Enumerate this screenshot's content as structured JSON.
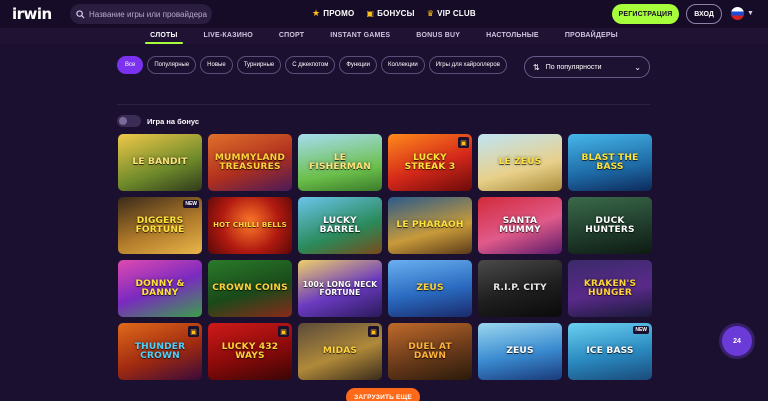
{
  "header": {
    "logo": "irwin",
    "search": {
      "placeholder": "Название игры или провайдера"
    },
    "links": [
      {
        "label": "ПРОМО",
        "icon": "star-icon"
      },
      {
        "label": "БОНУСЫ",
        "icon": "gift-icon"
      },
      {
        "label": "VIP CLUB",
        "icon": "crown-icon"
      }
    ],
    "register_label": "РЕГИСТРАЦИЯ",
    "login_label": "ВХОД",
    "language": "ru"
  },
  "nav": {
    "items": [
      "СЛОТЫ",
      "LIVE-КАЗИНО",
      "СПОРТ",
      "INSTANT GAMES",
      "BONUS BUY",
      "НАСТОЛЬНЫЕ",
      "ПРОВАЙДЕРЫ"
    ],
    "active": "СЛОТЫ"
  },
  "filters": {
    "chips": [
      "Все",
      "Популярные",
      "Новые",
      "Турнирные",
      "С джекпотом",
      "Функции",
      "Коллекции",
      "Игры для хайроллеров"
    ],
    "active": "Все"
  },
  "sort": {
    "label": "По популярности"
  },
  "bonus_toggle": {
    "label": "Игра на бонус",
    "on": false
  },
  "games": [
    {
      "name": "LE BANDIT",
      "badge": ""
    },
    {
      "name": "MUMMYLAND TREASURES",
      "badge": ""
    },
    {
      "name": "LE FISHERMAN",
      "badge": ""
    },
    {
      "name": "LUCKY STREAK 3",
      "badge": "gift"
    },
    {
      "name": "LE ZEUS",
      "badge": ""
    },
    {
      "name": "BLAST THE BASS",
      "badge": ""
    },
    {
      "name": "DIGGERS FORTUNE",
      "badge": "NEW"
    },
    {
      "name": "HOT CHILLI BELLS",
      "badge": ""
    },
    {
      "name": "LUCKY BARREL",
      "badge": ""
    },
    {
      "name": "LE PHARAOH",
      "badge": ""
    },
    {
      "name": "SANTA MUMMY",
      "badge": ""
    },
    {
      "name": "DUCK HUNTERS",
      "badge": ""
    },
    {
      "name": "DONNY & DANNY",
      "badge": ""
    },
    {
      "name": "CROWN COINS",
      "badge": ""
    },
    {
      "name": "100x LONG NECK FORTUNE",
      "badge": ""
    },
    {
      "name": "ZEUS",
      "badge": ""
    },
    {
      "name": "R.I.P. CITY",
      "badge": ""
    },
    {
      "name": "KRAKEN'S HUNGER",
      "badge": ""
    },
    {
      "name": "THUNDER CROWN",
      "badge": "gift"
    },
    {
      "name": "LUCKY 432 WAYS",
      "badge": "gift"
    },
    {
      "name": "MIDAS",
      "badge": "gift"
    },
    {
      "name": "DUEL AT DAWN",
      "badge": ""
    },
    {
      "name": "ZEUS",
      "badge": ""
    },
    {
      "name": "ICE BASS",
      "badge": "NEW"
    }
  ],
  "load_more_label": "ЗАГРУЗИТЬ ЕЩЕ",
  "support_label": "24",
  "colors": {
    "background": "#1c1030",
    "accent_green": "#a6ff3a",
    "accent_purple": "#7a32f0",
    "accent_orange": "#ff6a1a"
  }
}
